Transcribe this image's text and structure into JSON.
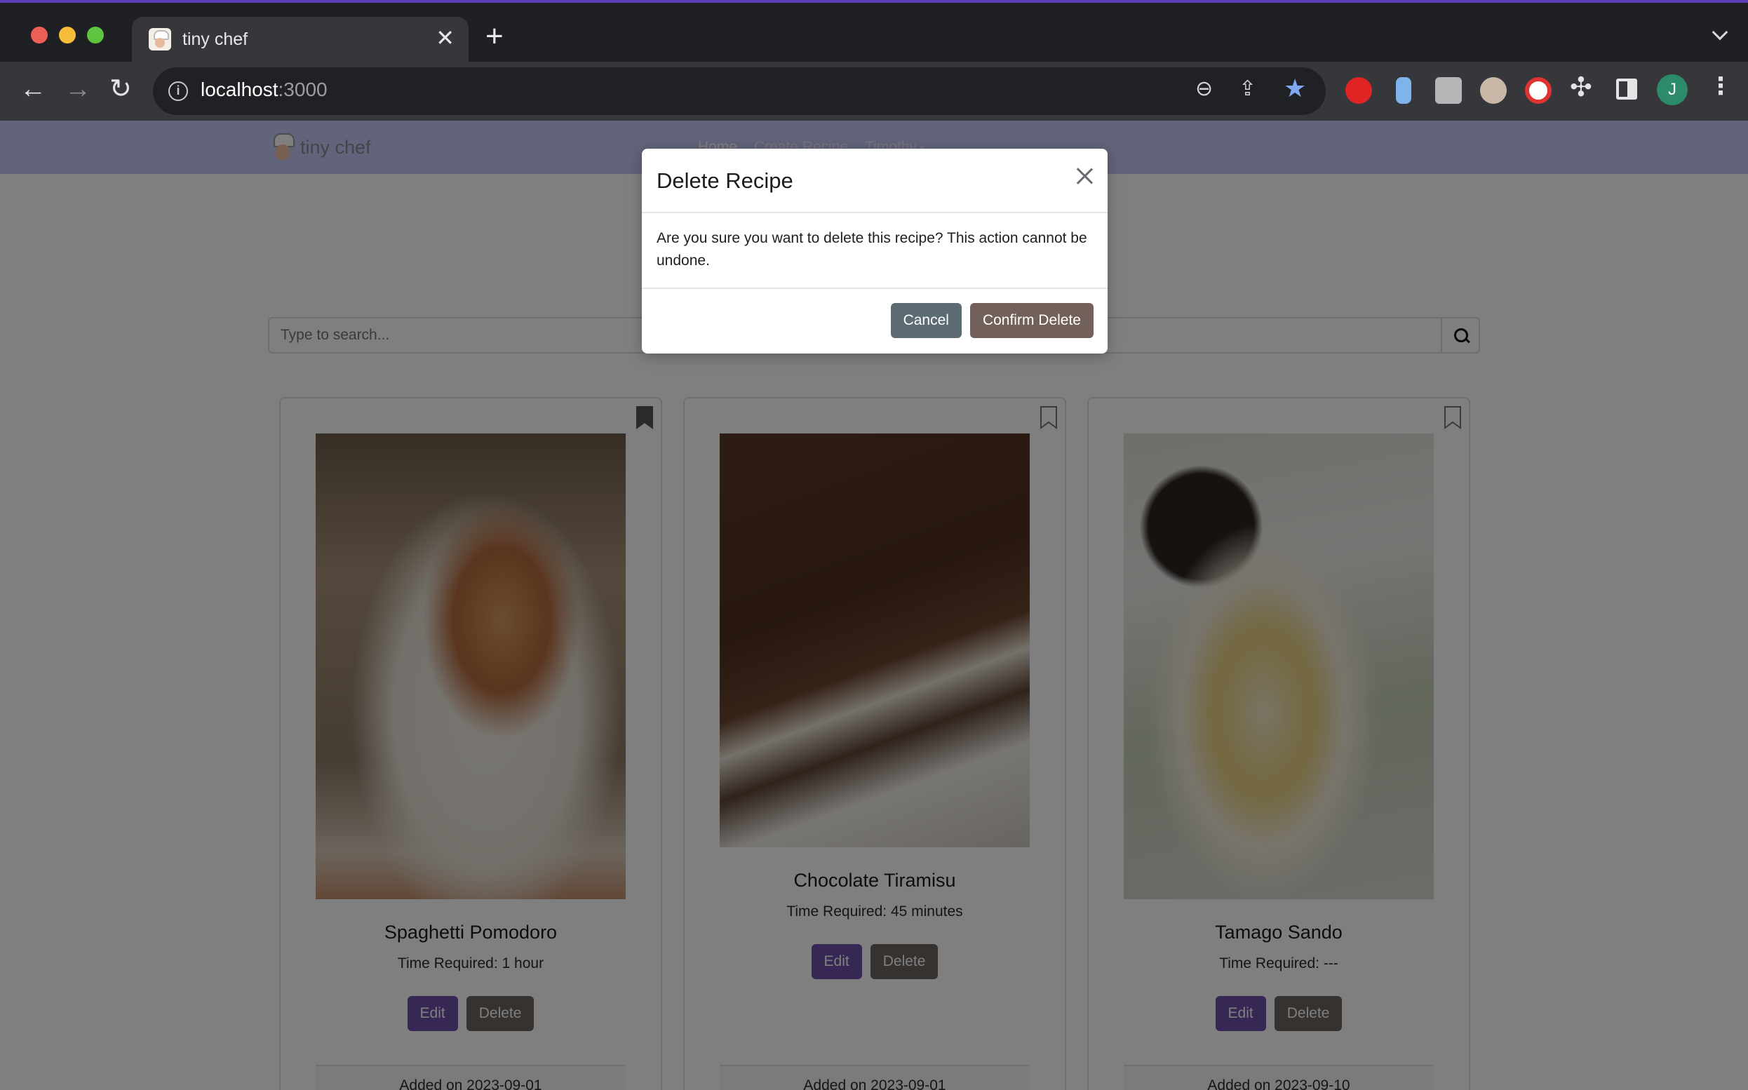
{
  "browser": {
    "tab_title": "tiny chef",
    "url_host": "localhost",
    "url_port": ":3000",
    "profile_initial": "J",
    "icons": [
      "back-icon",
      "forward-icon",
      "reload-icon",
      "info-icon",
      "zoom-icon",
      "share-icon",
      "star-icon",
      "puzzle-icon",
      "side-panel-icon",
      "kebab-icon"
    ]
  },
  "navbar": {
    "brand": "tiny chef",
    "links": [
      "Home",
      "Create Recipe",
      "Timothy"
    ]
  },
  "search": {
    "placeholder": "Type to search..."
  },
  "recipes": [
    {
      "title": "Spaghetti Pomodoro",
      "time": "Time Required: 1 hour",
      "edit_label": "Edit",
      "delete_label": "Delete",
      "added": "Added on 2023-09-01",
      "bookmarked": true
    },
    {
      "title": "Chocolate Tiramisu",
      "time": "Time Required: 45 minutes",
      "edit_label": "Edit",
      "delete_label": "Delete",
      "added": "Added on 2023-09-01",
      "bookmarked": false
    },
    {
      "title": "Tamago Sando",
      "time": "Time Required: ---",
      "edit_label": "Edit",
      "delete_label": "Delete",
      "added": "Added on 2023-09-10",
      "bookmarked": false
    }
  ],
  "modal": {
    "title": "Delete Recipe",
    "body": "Are you sure you want to delete this recipe? This action cannot be undone.",
    "cancel_label": "Cancel",
    "confirm_label": "Confirm Delete"
  },
  "colors": {
    "navbar": "#c3c8f4",
    "edit_button": "#6f4ea8",
    "delete_button": "#6b6560",
    "cancel_button": "#5d6b72",
    "confirm_button": "#72605a"
  }
}
